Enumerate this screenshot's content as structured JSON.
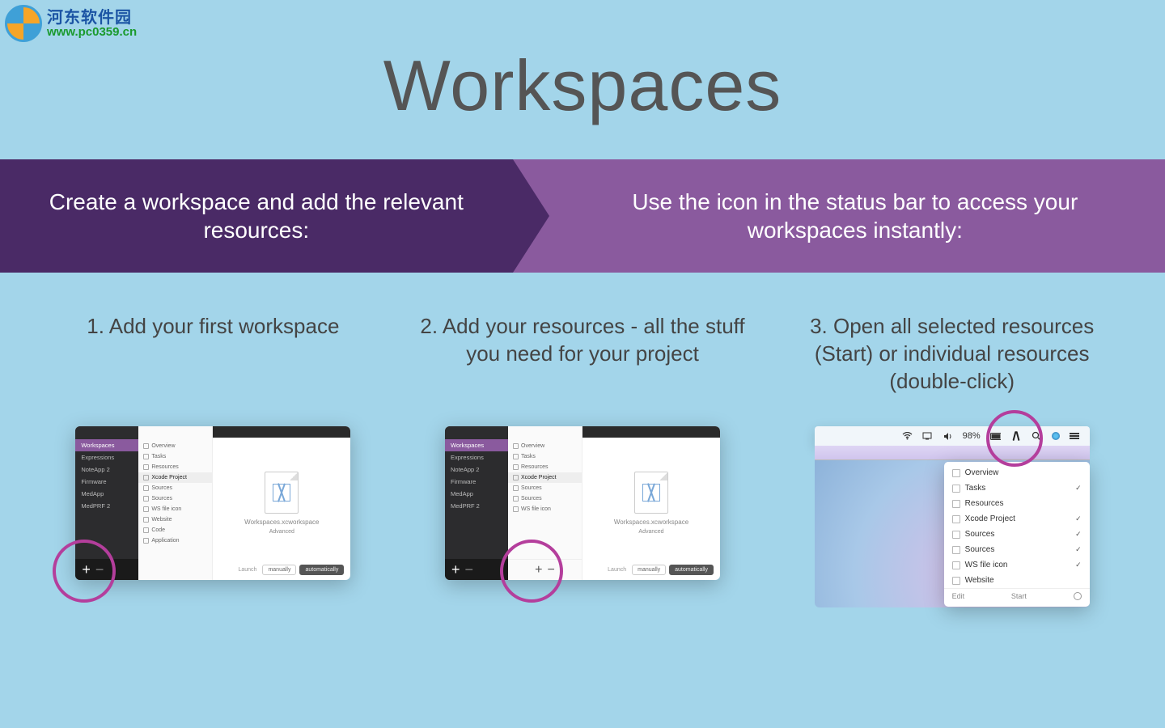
{
  "watermark": {
    "cn": "河东软件园",
    "url": "www.pc0359.cn"
  },
  "title": "Workspaces",
  "banner": {
    "left": "Create a workspace and add the relevant resources:",
    "right": "Use the icon in the status bar to access your workspaces instantly:"
  },
  "steps": {
    "s1": "1. Add your first workspace",
    "s2": "2. Add your resources - all the stuff you need for your project",
    "s3": "3. Open all selected resources (Start) or individual resources (double-click)"
  },
  "sidebar_items": [
    "Workspaces",
    "Expressions",
    "NoteApp 2",
    "Firmware",
    "MedApp",
    "MedPRF 2"
  ],
  "midcol_items": [
    "Overview",
    "Tasks",
    "Resources",
    "Xcode Project",
    "Sources",
    "Sources",
    "WS file icon",
    "Website",
    "Code",
    "Application"
  ],
  "midcol_items2": [
    "Overview",
    "Tasks",
    "Resources",
    "Xcode Project",
    "Sources",
    "Sources",
    "WS file icon"
  ],
  "doc_label": "Workspaces.xcworkspace",
  "advanced": "Advanced",
  "launch": "Launch",
  "manually": "manually",
  "automatically": "automatically",
  "menubar": {
    "battery": "98%"
  },
  "dropdown": {
    "items": [
      {
        "label": "Overview",
        "chk": false,
        "icon": true
      },
      {
        "label": "Tasks",
        "chk": true,
        "icon": true
      },
      {
        "label": "Resources",
        "chk": false,
        "icon": true
      },
      {
        "label": "Xcode Project",
        "chk": true,
        "icon": true
      },
      {
        "label": "Sources",
        "chk": true,
        "icon": true
      },
      {
        "label": "Sources",
        "chk": true,
        "icon": true
      },
      {
        "label": "WS file icon",
        "chk": true,
        "icon": true
      },
      {
        "label": "Website",
        "chk": false,
        "icon": true
      }
    ],
    "edit": "Edit",
    "start": "Start"
  }
}
